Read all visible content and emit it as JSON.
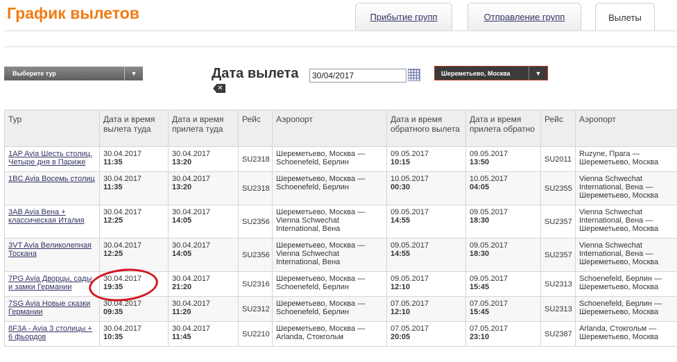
{
  "header": {
    "title": "График вылетов"
  },
  "tabs": [
    {
      "label": "Прибытие групп",
      "active": false
    },
    {
      "label": "Отправление групп",
      "active": false
    },
    {
      "label": "Вылеты",
      "active": true
    }
  ],
  "filters": {
    "tour_select": "Выберите тур",
    "date_label": "Дата вылета",
    "date_value": "30/04/2017",
    "airport_select": "Шереметьево, Москва"
  },
  "table": {
    "headers": [
      "Тур",
      "Дата и время вылета туда",
      "Дата и время прилета туда",
      "Рейс",
      "Аэропорт",
      "Дата и время обратного вылета",
      "Дата и время прилета обратно",
      "Рейс",
      "Аэропорт"
    ],
    "rows": [
      {
        "tour": "1AP Avia Шесть столиц. Четыре дня в Париже",
        "dep_date": "30.04.2017",
        "dep_time": "11:35",
        "arr_date": "30.04.2017",
        "arr_time": "13:20",
        "flight": "SU2318",
        "airport": "Шереметьево, Москва — Schoenefeld, Берлин",
        "ret_dep_date": "09.05.2017",
        "ret_dep_time": "10:15",
        "ret_arr_date": "09.05.2017",
        "ret_arr_time": "13:50",
        "ret_flight": "SU2011",
        "ret_airport": "Ruzyne, Прага — Шереметьево, Москва"
      },
      {
        "tour": "1BC Avia Восемь столиц",
        "dep_date": "30.04.2017",
        "dep_time": "11:35",
        "arr_date": "30.04.2017",
        "arr_time": "13:20",
        "flight": "SU2318",
        "airport": "Шереметьево, Москва — Schoenefeld, Берлин",
        "ret_dep_date": "10.05.2017",
        "ret_dep_time": "00:30",
        "ret_arr_date": "10.05.2017",
        "ret_arr_time": "04:05",
        "ret_flight": "SU2355",
        "ret_airport": "Vienna Schwechat International, Вена — Шереметьево, Москва"
      },
      {
        "tour": "3AB Avia Вена + классическая Италия",
        "dep_date": "30.04.2017",
        "dep_time": "12:25",
        "arr_date": "30.04.2017",
        "arr_time": "14:05",
        "flight": "SU2356",
        "airport": "Шереметьево, Москва — Vienna Schwechat International, Вена",
        "ret_dep_date": "09.05.2017",
        "ret_dep_time": "14:55",
        "ret_arr_date": "09.05.2017",
        "ret_arr_time": "18:30",
        "ret_flight": "SU2357",
        "ret_airport": "Vienna Schwechat International, Вена — Шереметьево, Москва"
      },
      {
        "tour": "3VT Avia Великолепная Тоскана",
        "dep_date": "30.04.2017",
        "dep_time": "12:25",
        "arr_date": "30.04.2017",
        "arr_time": "14:05",
        "flight": "SU2356",
        "airport": "Шереметьево, Москва — Vienna Schwechat International, Вена",
        "ret_dep_date": "09.05.2017",
        "ret_dep_time": "14:55",
        "ret_arr_date": "09.05.2017",
        "ret_arr_time": "18:30",
        "ret_flight": "SU2357",
        "ret_airport": "Vienna Schwechat International, Вена — Шереметьево, Москва"
      },
      {
        "tour": "7PG Avia Дворцы, сады и замки Германии",
        "dep_date": "30.04.2017",
        "dep_time": "19:35",
        "arr_date": "30.04.2017",
        "arr_time": "21:20",
        "flight": "SU2316",
        "airport": "Шереметьево, Москва — Schoenefeld, Берлин",
        "ret_dep_date": "09.05.2017",
        "ret_dep_time": "12:10",
        "ret_arr_date": "09.05.2017",
        "ret_arr_time": "15:45",
        "ret_flight": "SU2313",
        "ret_airport": "Schoenefeld, Берлин — Шереметьево, Москва"
      },
      {
        "tour": "7SG Avia Новые сказки Германии",
        "dep_date": "30.04.2017",
        "dep_time": "09:35",
        "arr_date": "30.04.2017",
        "arr_time": "11:20",
        "flight": "SU2312",
        "airport": "Шереметьево, Москва — Schoenefeld, Берлин",
        "ret_dep_date": "07.05.2017",
        "ret_dep_time": "12:10",
        "ret_arr_date": "07.05.2017",
        "ret_arr_time": "15:45",
        "ret_flight": "SU2313",
        "ret_airport": "Schoenefeld, Берлин — Шереметьево, Москва"
      },
      {
        "tour": "8F3A - Avia 3 столицы + 6 фьордов",
        "dep_date": "30.04.2017",
        "dep_time": "10:35",
        "arr_date": "30.04.2017",
        "arr_time": "11:45",
        "flight": "SU2210",
        "airport": "Шереметьево, Москва — Arlanda, Стокгольм",
        "ret_dep_date": "07.05.2017",
        "ret_dep_time": "20:05",
        "ret_arr_date": "07.05.2017",
        "ret_arr_time": "23:10",
        "ret_flight": "SU2387",
        "ret_airport": "Arlanda, Стокгольм — Шереметьево, Москва"
      }
    ]
  },
  "annotation": {
    "color": "#d4141e"
  }
}
